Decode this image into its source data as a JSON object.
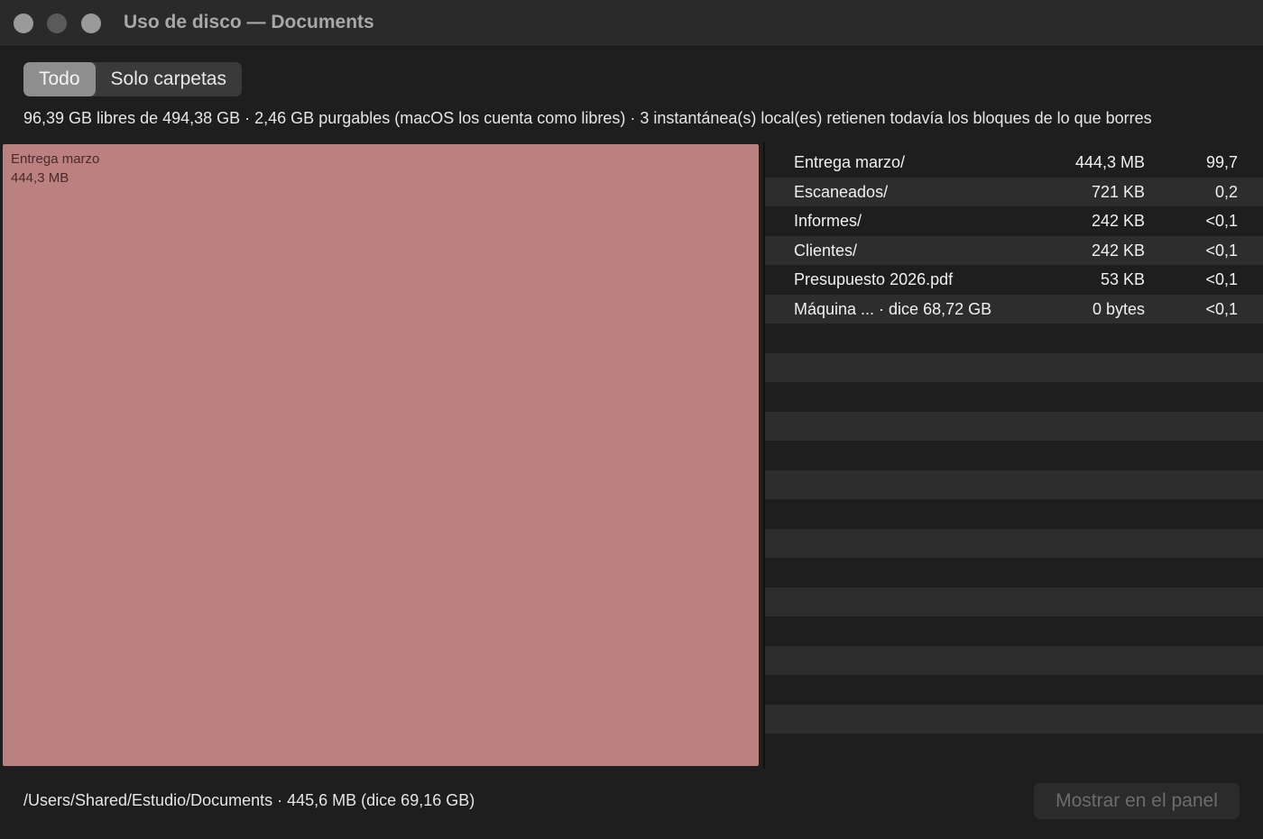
{
  "window": {
    "title": "Uso de disco — Documents"
  },
  "view_mode": {
    "options": [
      "Todo",
      "Solo carpetas"
    ],
    "selected": "Todo"
  },
  "info_line": "96,39 GB libres de 494,38 GB · 2,46 GB purgables (macOS los cuenta como libres) · 3 instantánea(s) local(es) retienen todavía los bloques de lo que borres",
  "treemap": {
    "tiles": [
      {
        "name": "Entrega marzo",
        "size": "444,3 MB",
        "color": "#bb8080"
      }
    ]
  },
  "list": {
    "rows": [
      {
        "name": "Entrega marzo/",
        "size": "444,3 MB",
        "percent": "99,7"
      },
      {
        "name": "Escaneados/",
        "size": "721 KB",
        "percent": "0,2"
      },
      {
        "name": "Informes/",
        "size": "242 KB",
        "percent": "<0,1"
      },
      {
        "name": "Clientes/",
        "size": "242 KB",
        "percent": "<0,1"
      },
      {
        "name": "Presupuesto 2026.pdf",
        "size": "53 KB",
        "percent": "<0,1"
      },
      {
        "name": "Máquina ... · dice 68,72 GB",
        "size": "0 bytes",
        "percent": "<0,1"
      }
    ]
  },
  "footer": {
    "path": "/Users/Shared/Estudio/Documents · 445,6 MB (dice 69,16 GB)",
    "reveal_button": "Mostrar en el panel",
    "reveal_enabled": false
  },
  "colors": {
    "background": "#1e1e1e",
    "tile": "#bb8080",
    "segment_active": "#8e8e8e"
  }
}
